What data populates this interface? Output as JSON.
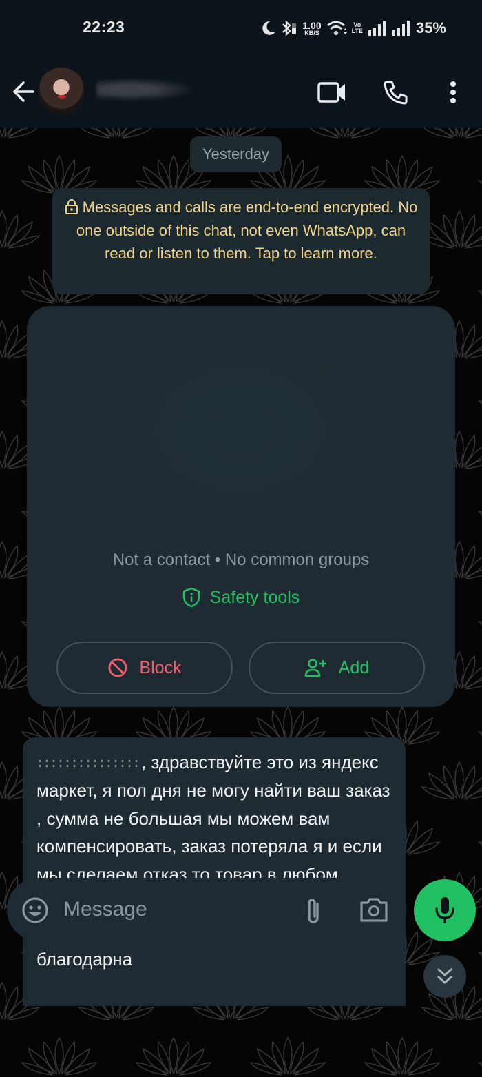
{
  "status_bar": {
    "time": "22:23",
    "net_speed_value": "1.00",
    "net_speed_unit": "KB/S",
    "volte_top": "Vo",
    "volte_bottom": "LTE",
    "battery": "35%",
    "icons": [
      "moon-icon",
      "bluetooth-icon",
      "wifi-icon",
      "signal-icon",
      "signal-icon"
    ]
  },
  "header": {
    "contact_name": "[redacted]",
    "back_icon": "arrow-left-icon",
    "actions": [
      "video-call-icon",
      "phone-icon",
      "more-vert-icon"
    ]
  },
  "chat": {
    "date_chip": "Yesterday",
    "e2e_notice": "Messages and calls are end-to-end encrypted. No one outside of this chat, not even WhatsApp, can read or listen to them. Tap to learn more.",
    "profile_card": {
      "info_line": "Not a contact • No common groups",
      "safety_tools_label": "Safety tools",
      "block_label": "Block",
      "add_label": "Add"
    },
    "messages": [
      {
        "direction": "incoming",
        "redacted_prefix": true,
        "text": ", здравствуйте это из яндекс маркет, я пол дня не могу найти ваш заказ , сумма не большая мы можем вам компенсировать, заказ потеряла я и если мы сделаем отказ то товар в любом случае не вернется человеку и это не очень приятная ситуация, буду очень благодарна"
      }
    ]
  },
  "input_bar": {
    "placeholder": "Message",
    "value": ""
  },
  "colors": {
    "accent_green": "#21c063",
    "danger_red": "#f15c6d",
    "e2e_text": "#f1d28a",
    "bubble_bg": "#1f2b32",
    "header_bg": "#0b141a"
  }
}
